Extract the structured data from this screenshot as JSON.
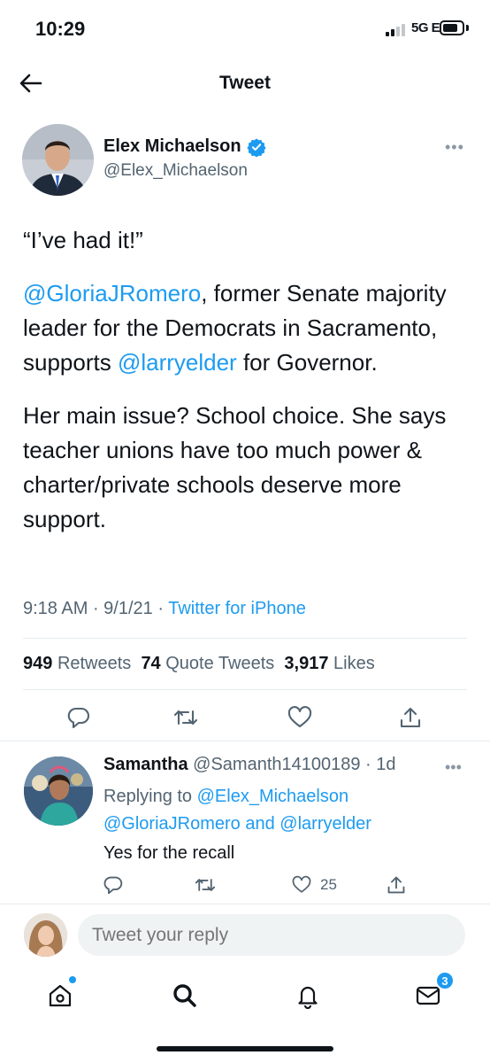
{
  "status_bar": {
    "time": "10:29",
    "network": "5G E"
  },
  "header": {
    "title": "Tweet"
  },
  "tweet": {
    "author_name": "Elex Michaelson",
    "author_handle": "@Elex_Michaelson",
    "quote": "“I’ve had it!”",
    "mention_1": "@GloriaJRomero",
    "text_1": ", former Senate majority leader for the Democrats in Sacramento, supports ",
    "mention_2": "@larryelder",
    "text_2": " for Governor.",
    "paragraph_3": "Her main issue? School choice. She says teacher unions have too much power & charter/private schools deserve more support.",
    "time": "9:18 AM",
    "date": "9/1/21",
    "app": "Twitter for iPhone",
    "retweets_count": "949",
    "retweets_label": "Retweets",
    "quotes_count": "74",
    "quotes_label": "Quote Tweets",
    "likes_count": "3,917",
    "likes_label": "Likes"
  },
  "reply": {
    "name": "Samantha",
    "handle": "@Samanth14100189",
    "age": "1d",
    "replying_label": "Replying to",
    "replying_to_1": "@Elex_Michaelson",
    "replying_to_2": "@GloriaJRomero",
    "and_label": "and",
    "replying_to_3": "@larryelder",
    "text": "Yes for the recall",
    "like_count": "25"
  },
  "composer": {
    "placeholder": "Tweet your reply"
  },
  "tab_bar": {
    "messages_badge": "3"
  },
  "colors": {
    "accent": "#1d9bf0",
    "text": "#0f1419",
    "secondary": "#536471",
    "divider": "#e6ecf0"
  }
}
